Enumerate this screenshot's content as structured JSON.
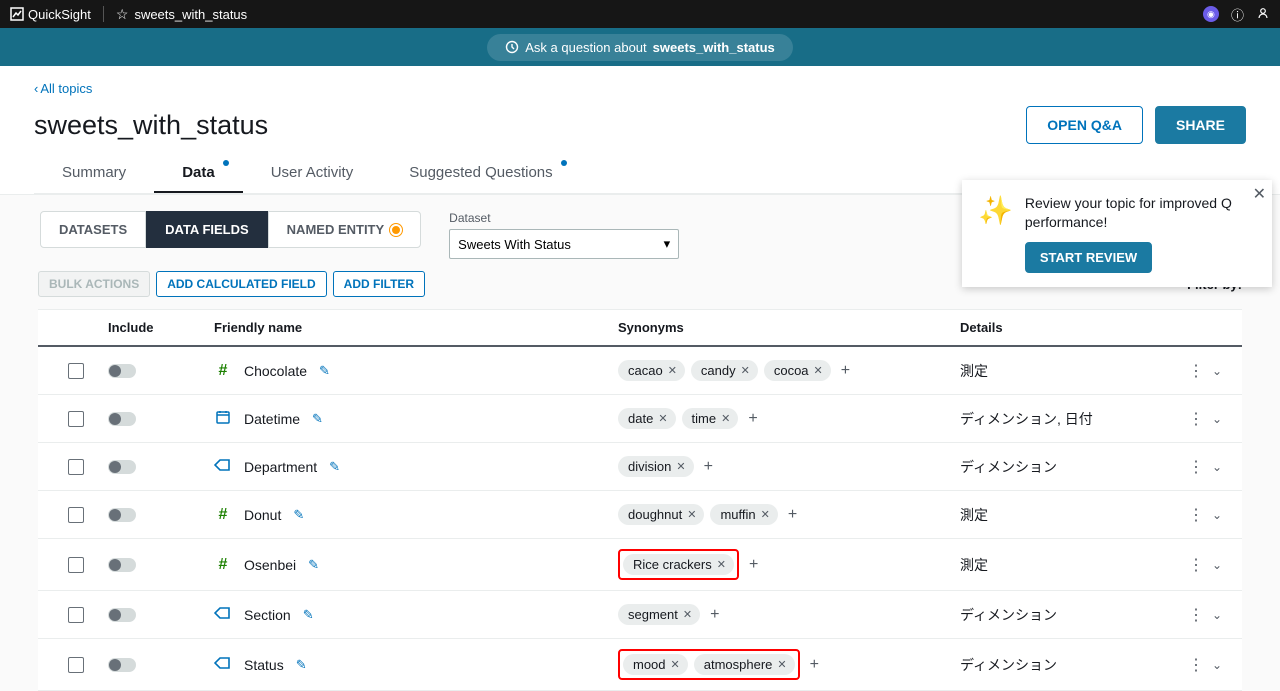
{
  "topbar": {
    "product": "QuickSight",
    "topic": "sweets_with_status"
  },
  "qbar": {
    "prefix": "Ask a question about ",
    "bold": "sweets_with_status"
  },
  "breadcrumb": "All topics",
  "title": "sweets_with_status",
  "buttons": {
    "open_qa": "OPEN Q&A",
    "share": "SHARE"
  },
  "tabs": {
    "summary": "Summary",
    "data": "Data",
    "user_activity": "User Activity",
    "suggested": "Suggested Questions"
  },
  "subtabs": {
    "datasets": "DATASETS",
    "data_fields": "DATA FIELDS",
    "named_entity": "NAMED ENTITY"
  },
  "dataset": {
    "label": "Dataset",
    "value": "Sweets With Status"
  },
  "toolbar": {
    "bulk": "BULK ACTIONS",
    "calc": "ADD CALCULATED FIELD",
    "filter": "ADD FILTER",
    "filter_by": "Filter by:"
  },
  "popup": {
    "text": "Review your topic for improved Q performance!",
    "cta": "START REVIEW"
  },
  "columns": {
    "include": "Include",
    "name": "Friendly name",
    "synonyms": "Synonyms",
    "details": "Details"
  },
  "rows": [
    {
      "type": "measure",
      "name": "Chocolate",
      "syn": [
        "cacao",
        "candy",
        "cocoa"
      ],
      "details": "測定",
      "hl": false
    },
    {
      "type": "date",
      "name": "Datetime",
      "syn": [
        "date",
        "time"
      ],
      "details": "ディメンション, 日付",
      "hl": false
    },
    {
      "type": "dim",
      "name": "Department",
      "syn": [
        "division"
      ],
      "details": "ディメンション",
      "hl": false
    },
    {
      "type": "measure",
      "name": "Donut",
      "syn": [
        "doughnut",
        "muffin"
      ],
      "details": "測定",
      "hl": false
    },
    {
      "type": "measure",
      "name": "Osenbei",
      "syn": [
        "Rice crackers"
      ],
      "details": "測定",
      "hl": true
    },
    {
      "type": "dim",
      "name": "Section",
      "syn": [
        "segment"
      ],
      "details": "ディメンション",
      "hl": false
    },
    {
      "type": "dim",
      "name": "Status",
      "syn": [
        "mood",
        "atmosphere"
      ],
      "details": "ディメンション",
      "hl": true
    }
  ]
}
